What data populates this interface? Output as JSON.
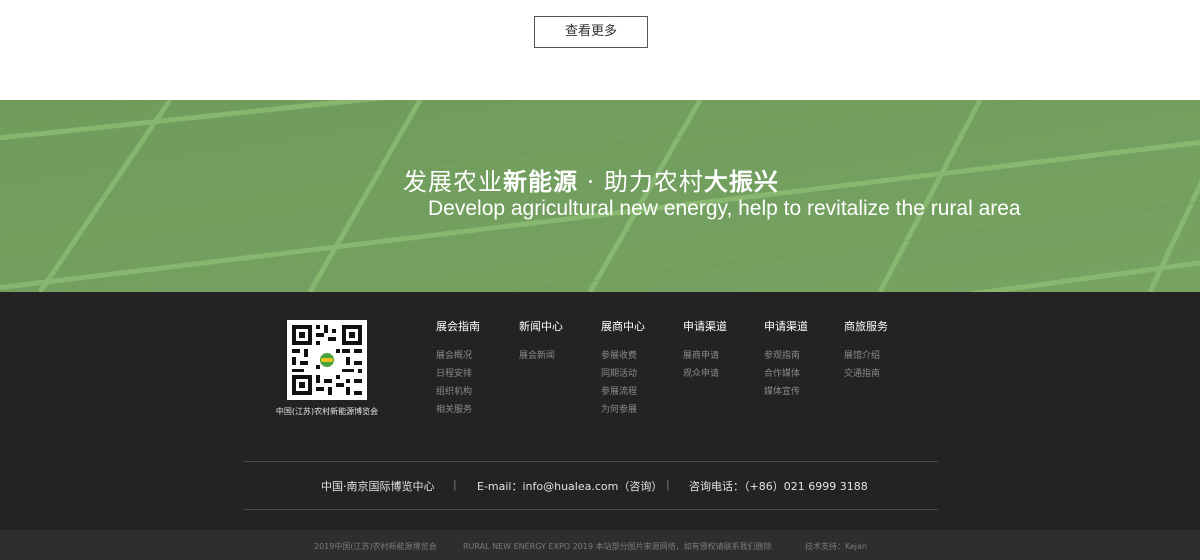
{
  "top": {
    "more_button": "查看更多"
  },
  "banner": {
    "slogan_cn_part1": "发展农业",
    "slogan_cn_bold1": "新能源",
    "slogan_cn_part2": " · 助力农村",
    "slogan_cn_bold2": "大振兴",
    "slogan_en": "Develop agricultural new energy, help to revitalize the rural area"
  },
  "footer": {
    "qr_label": "中国(江苏)农村新能源博览会",
    "columns": [
      {
        "head": "展会指南",
        "links": [
          "展会概况",
          "日程安排",
          "组织机构",
          "相关服务"
        ]
      },
      {
        "head": "新闻中心",
        "links": [
          "展会新闻"
        ]
      },
      {
        "head": "展商中心",
        "links": [
          "参展收费",
          "同期活动",
          "参展流程",
          "为何参展"
        ]
      },
      {
        "head": "申请渠道",
        "links": [
          "展商申请",
          "观众申请"
        ]
      },
      {
        "head": "申请渠道",
        "links": [
          "参观指南",
          "合作媒体",
          "媒体宣传"
        ]
      },
      {
        "head": "商旅服务",
        "links": [
          "展馆介绍",
          "交通指南"
        ]
      }
    ],
    "contact": {
      "venue": "中国·南京国际博览中心",
      "email": "E-mail：info@hualea.com（咨询）",
      "phone": "咨询电话：（+86）021 6999 3188",
      "separator": "|"
    }
  },
  "copyright": {
    "left": "2019中国(江苏)农村新能源博览会",
    "middle": "RURAL NEW ENERGY EXPO 2019 本站部分图片来源网络，如有侵权请联系我们删除",
    "right": "技术支持：Kejan"
  },
  "colors": {
    "banner_green": "#6e9a5b",
    "footer_dark": "#232325",
    "copyright_bar": "#2e2e30"
  }
}
